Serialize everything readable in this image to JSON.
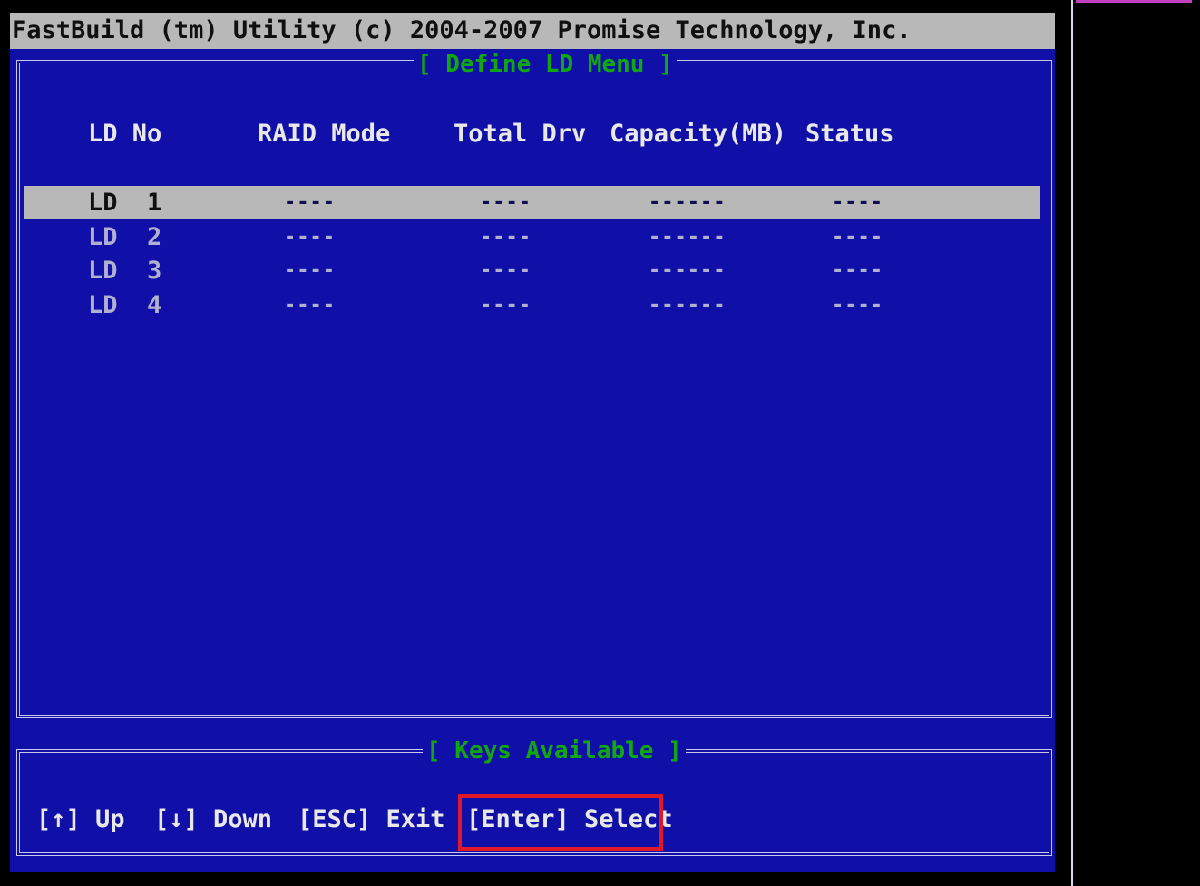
{
  "header": {
    "title": "FastBuild (tm) Utility (c) 2004-2007 Promise Technology, Inc."
  },
  "menu": {
    "title": "[ Define LD Menu ]",
    "columns": [
      "LD No",
      "RAID Mode",
      "Total Drv",
      "Capacity(MB)",
      "Status"
    ],
    "rows": [
      {
        "ld_no": "LD  1",
        "raid_mode": "----",
        "total_drv": "----",
        "capacity": "------",
        "status": "----",
        "selected": true
      },
      {
        "ld_no": "LD  2",
        "raid_mode": "----",
        "total_drv": "----",
        "capacity": "------",
        "status": "----",
        "selected": false
      },
      {
        "ld_no": "LD  3",
        "raid_mode": "----",
        "total_drv": "----",
        "capacity": "------",
        "status": "----",
        "selected": false
      },
      {
        "ld_no": "LD  4",
        "raid_mode": "----",
        "total_drv": "----",
        "capacity": "------",
        "status": "----",
        "selected": false
      }
    ]
  },
  "keys": {
    "title": "[ Keys Available ]",
    "up": "[↑] Up",
    "down": "[↓] Down",
    "esc": "[ESC] Exit",
    "enter": "[Enter] Select"
  },
  "colors": {
    "background": "#1010a8",
    "title_bar": "#b8b8b8",
    "frame_title": "#10a810",
    "highlight_box": "#e01828"
  }
}
